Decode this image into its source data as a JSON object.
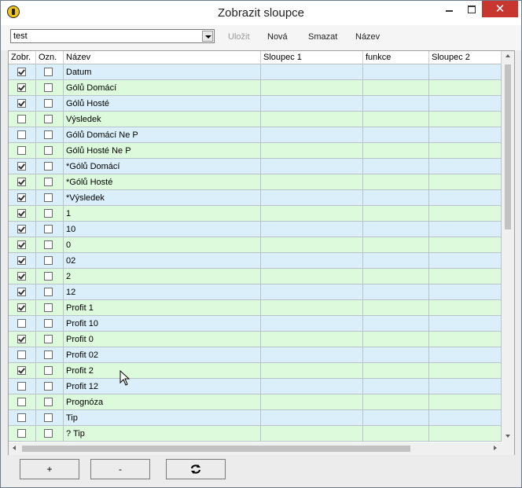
{
  "window": {
    "title": "Zobrazit sloupce"
  },
  "toolbar": {
    "combo_value": "test",
    "save_label": "Uložit",
    "new_label": "Nová",
    "delete_label": "Smazat",
    "name_label": "Název"
  },
  "columns": {
    "show": "Zobr.",
    "mark": "Ozn.",
    "name": "Název",
    "col1": "Sloupec 1",
    "func": "funkce",
    "col2": "Sloupec 2"
  },
  "rows": [
    {
      "show": true,
      "mark": false,
      "name": "Datum"
    },
    {
      "show": true,
      "mark": false,
      "name": "Gólů Domácí"
    },
    {
      "show": true,
      "mark": false,
      "name": "Gólů Hosté"
    },
    {
      "show": false,
      "mark": false,
      "name": "Výsledek"
    },
    {
      "show": false,
      "mark": false,
      "name": "Gólů Domácí Ne P"
    },
    {
      "show": false,
      "mark": false,
      "name": "Gólů Hosté Ne P"
    },
    {
      "show": true,
      "mark": false,
      "name": "*Gólů Domácí"
    },
    {
      "show": true,
      "mark": false,
      "name": "*Gólů Hosté"
    },
    {
      "show": true,
      "mark": false,
      "name": "*Výsledek"
    },
    {
      "show": true,
      "mark": false,
      "name": "1"
    },
    {
      "show": true,
      "mark": false,
      "name": "10"
    },
    {
      "show": true,
      "mark": false,
      "name": "0"
    },
    {
      "show": true,
      "mark": false,
      "name": "02"
    },
    {
      "show": true,
      "mark": false,
      "name": "2"
    },
    {
      "show": true,
      "mark": false,
      "name": "12"
    },
    {
      "show": true,
      "mark": false,
      "name": "Profit 1"
    },
    {
      "show": false,
      "mark": false,
      "name": "Profit 10"
    },
    {
      "show": true,
      "mark": false,
      "name": "Profit 0"
    },
    {
      "show": false,
      "mark": false,
      "name": "Profit 02"
    },
    {
      "show": true,
      "mark": false,
      "name": "Profit 2"
    },
    {
      "show": false,
      "mark": false,
      "name": "Profit 12"
    },
    {
      "show": false,
      "mark": false,
      "name": "Prognóza"
    },
    {
      "show": false,
      "mark": false,
      "name": "Tip"
    },
    {
      "show": false,
      "mark": false,
      "name": "? Tip"
    }
  ],
  "bottom": {
    "add_label": "+",
    "remove_label": "-",
    "refresh_icon": "refresh-icon"
  },
  "colors": {
    "row_blue": "#dbeffb",
    "row_green": "#ddfadc",
    "close_red": "#c7372f"
  }
}
